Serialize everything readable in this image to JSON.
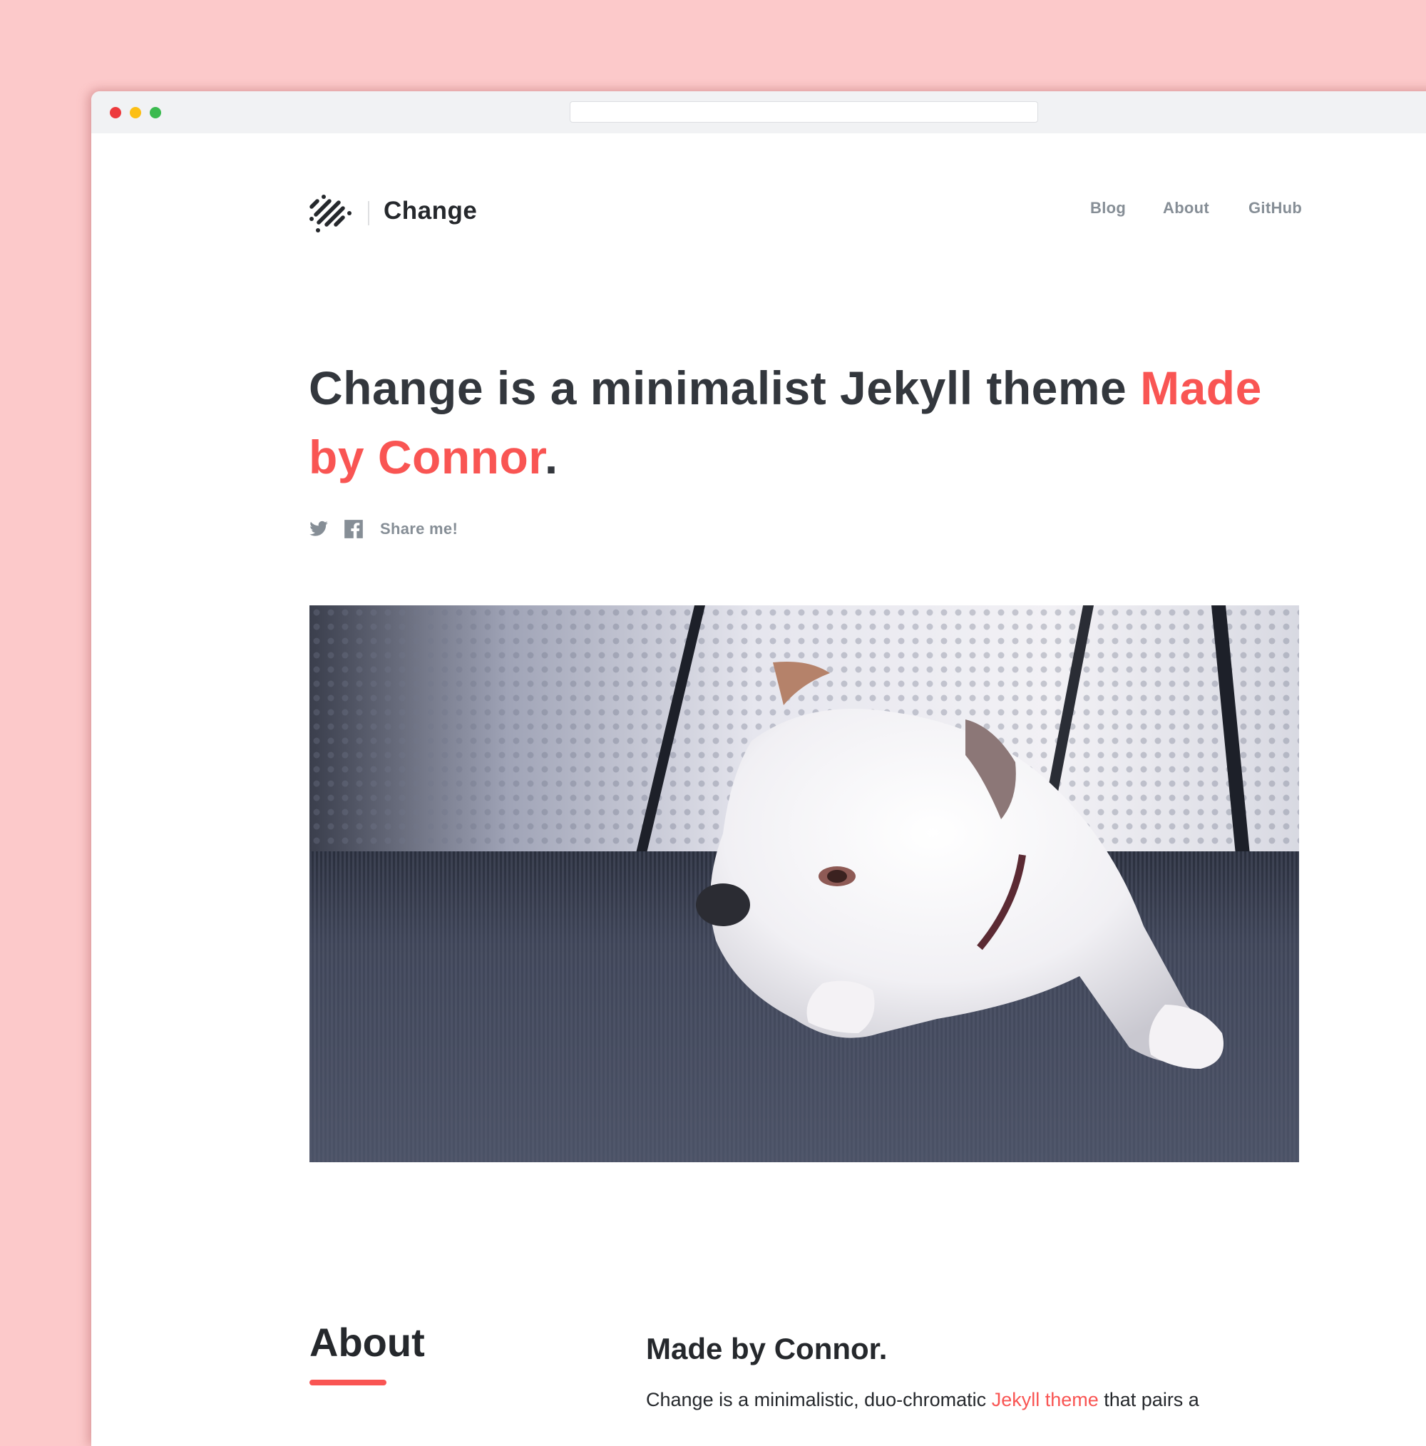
{
  "browser": {
    "traffic_lights": [
      "close",
      "minimize",
      "maximize"
    ],
    "url": ""
  },
  "site": {
    "brand": "Change",
    "logo_icon": "diagonal-stripes-logo-icon",
    "nav": [
      {
        "label": "Blog"
      },
      {
        "label": "About"
      },
      {
        "label": "GitHub"
      }
    ]
  },
  "hero": {
    "headline_part1": "Change is a minimalist Jekyll theme ",
    "headline_accent": "Made by Connor",
    "headline_end": ".",
    "share": {
      "twitter_icon": "twitter-icon",
      "facebook_icon": "facebook-icon",
      "label": "Share me!"
    },
    "image_alt": "White bulldog resting its head on its paws on a dark carpet"
  },
  "about": {
    "title": "About",
    "heading": "Made by Connor.",
    "body_before": "Change is a minimalistic, duo-chromatic ",
    "body_link": "Jekyll theme",
    "body_after": " that pairs a"
  },
  "colors": {
    "background": "#fcc9ca",
    "accent": "#f95553",
    "text_dark": "#33373d",
    "text_muted": "#868e96",
    "chrome": "#f1f2f4"
  }
}
